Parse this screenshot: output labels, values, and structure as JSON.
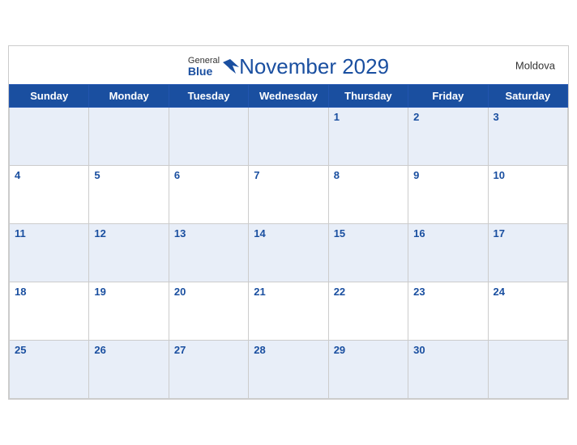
{
  "header": {
    "title": "November 2029",
    "country": "Moldova",
    "logo_general": "General",
    "logo_blue": "Blue"
  },
  "weekdays": [
    "Sunday",
    "Monday",
    "Tuesday",
    "Wednesday",
    "Thursday",
    "Friday",
    "Saturday"
  ],
  "weeks": [
    [
      null,
      null,
      null,
      null,
      1,
      2,
      3
    ],
    [
      4,
      5,
      6,
      7,
      8,
      9,
      10
    ],
    [
      11,
      12,
      13,
      14,
      15,
      16,
      17
    ],
    [
      18,
      19,
      20,
      21,
      22,
      23,
      24
    ],
    [
      25,
      26,
      27,
      28,
      29,
      30,
      null
    ]
  ]
}
